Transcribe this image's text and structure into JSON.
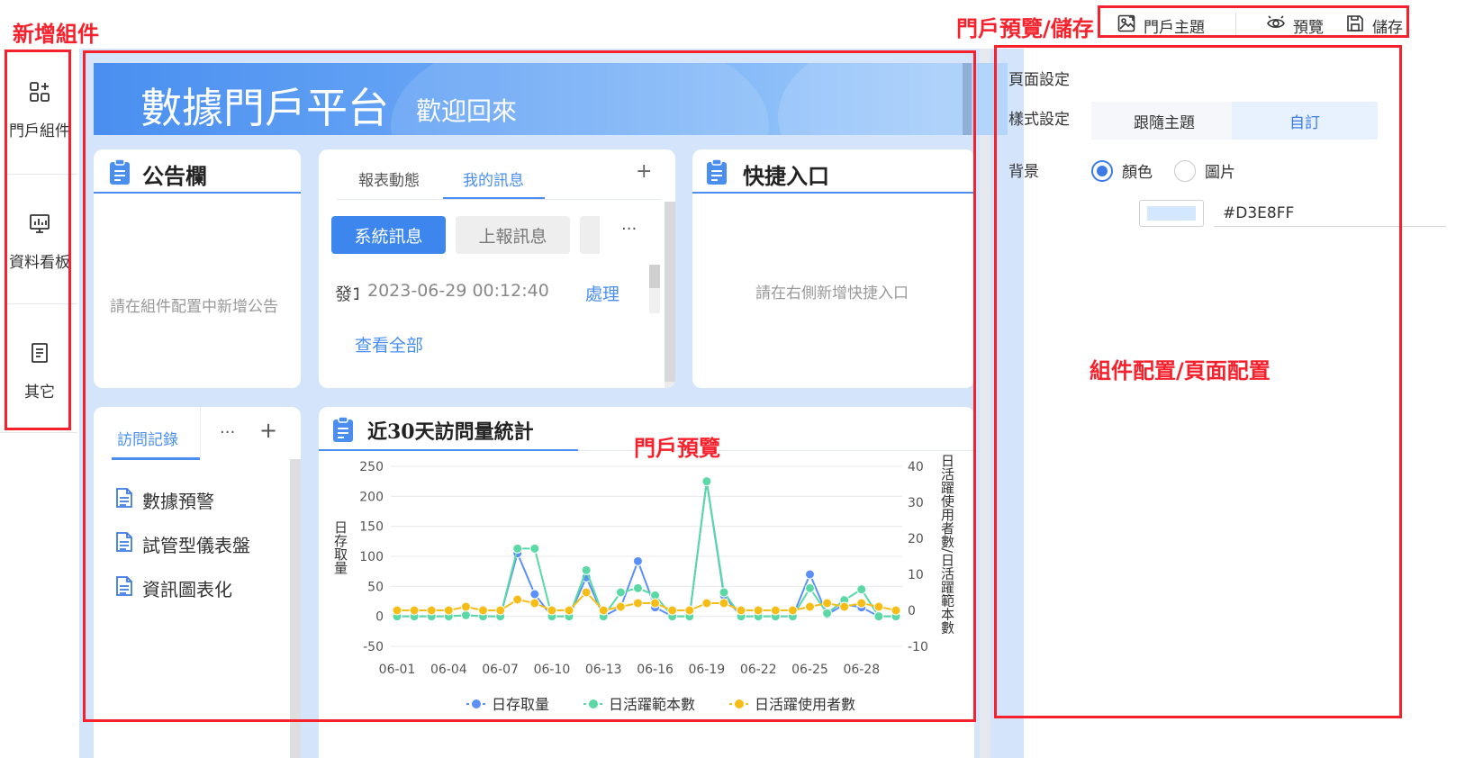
{
  "annotations": {
    "add_component": "新增組件",
    "preview_save": "門戶預覽/儲存",
    "portal_preview": "門戶預覽",
    "config": "組件配置/頁面配置"
  },
  "sidebar": {
    "items": [
      {
        "label": "門戶組件",
        "icon": "grid-plus-icon"
      },
      {
        "label": "資料看板",
        "icon": "dashboard-icon"
      },
      {
        "label": "其它",
        "icon": "document-icon"
      }
    ]
  },
  "toolbar": {
    "theme_label": "門戶主題",
    "preview_label": "預覽",
    "save_label": "儲存"
  },
  "banner": {
    "title": "數據門戶平台",
    "subtitle": "歡迎回來"
  },
  "announcement": {
    "title": "公告欄",
    "placeholder": "請在組件配置中新增公告"
  },
  "messages": {
    "tabs": [
      "報表動態",
      "我的訊息"
    ],
    "active_tab": 1,
    "add": "+",
    "sub_tabs": [
      "系統訊息",
      "上報訊息"
    ],
    "more": "···",
    "row": {
      "prefix": "發1",
      "time": "2023-06-29 00:12:40",
      "action": "處理"
    },
    "view_all": "查看全部"
  },
  "quick_entry": {
    "title": "快捷入口",
    "placeholder": "請在右側新增快捷入口"
  },
  "visits": {
    "tab": "訪問記錄",
    "more": "···",
    "add": "+",
    "items": [
      "數據預警",
      "試管型儀表盤",
      "資訊圖表化"
    ]
  },
  "stats": {
    "title": "近30天訪問量統計"
  },
  "chart_data": {
    "type": "line",
    "title": "近30天訪問量統計",
    "xlabel": "",
    "ylabel": "日存取量",
    "y2label": "日活躍使用者數/日活躍範本數",
    "x": [
      "06-01",
      "06-02",
      "06-03",
      "06-04",
      "06-05",
      "06-06",
      "06-07",
      "06-08",
      "06-09",
      "06-10",
      "06-11",
      "06-12",
      "06-13",
      "06-14",
      "06-15",
      "06-16",
      "06-17",
      "06-18",
      "06-19",
      "06-20",
      "06-21",
      "06-22",
      "06-23",
      "06-24",
      "06-25",
      "06-26",
      "06-27",
      "06-28",
      "06-29",
      "06-30"
    ],
    "x_tick_labels": [
      "06-01",
      "06-04",
      "06-07",
      "06-10",
      "06-13",
      "06-16",
      "06-19",
      "06-22",
      "06-25",
      "06-28"
    ],
    "ylim": [
      -50,
      250
    ],
    "y_ticks": [
      -50,
      0,
      50,
      100,
      150,
      200,
      250
    ],
    "y2lim": [
      -10,
      40
    ],
    "y2_ticks": [
      -10,
      0,
      10,
      20,
      30,
      40
    ],
    "series": [
      {
        "name": "日存取量",
        "axis": "left",
        "color": "#5b8ff9",
        "values": [
          0,
          0,
          0,
          0,
          2,
          0,
          0,
          105,
          37,
          0,
          0,
          65,
          0,
          15,
          92,
          15,
          0,
          0,
          225,
          35,
          0,
          0,
          0,
          0,
          70,
          3,
          20,
          15,
          0,
          0
        ]
      },
      {
        "name": "日活躍範本數",
        "axis": "left",
        "color": "#5ad8a6",
        "values": [
          0,
          0,
          0,
          0,
          2,
          0,
          0,
          113,
          113,
          0,
          0,
          77,
          0,
          40,
          47,
          35,
          0,
          0,
          225,
          40,
          0,
          0,
          0,
          0,
          47,
          5,
          27,
          45,
          0,
          0
        ]
      },
      {
        "name": "日活躍使用者數",
        "axis": "right",
        "color": "#f6bd16",
        "values": [
          0,
          0,
          0,
          0,
          1,
          0,
          0,
          3,
          2,
          0,
          0,
          5,
          0,
          1,
          2,
          2,
          0,
          0,
          2,
          2,
          0,
          0,
          0,
          0,
          1,
          2,
          1,
          2,
          1,
          0
        ]
      }
    ],
    "legend_position": "bottom"
  },
  "panel": {
    "page_settings": "頁面設定",
    "style_settings": "樣式設定",
    "style_options": [
      "跟隨主題",
      "自訂"
    ],
    "style_active": 1,
    "background": "背景",
    "bg_options": [
      "顏色",
      "圖片"
    ],
    "bg_active": 0,
    "color_hex": "#D3E8FF",
    "swatch_color": "#d3e8ff"
  }
}
